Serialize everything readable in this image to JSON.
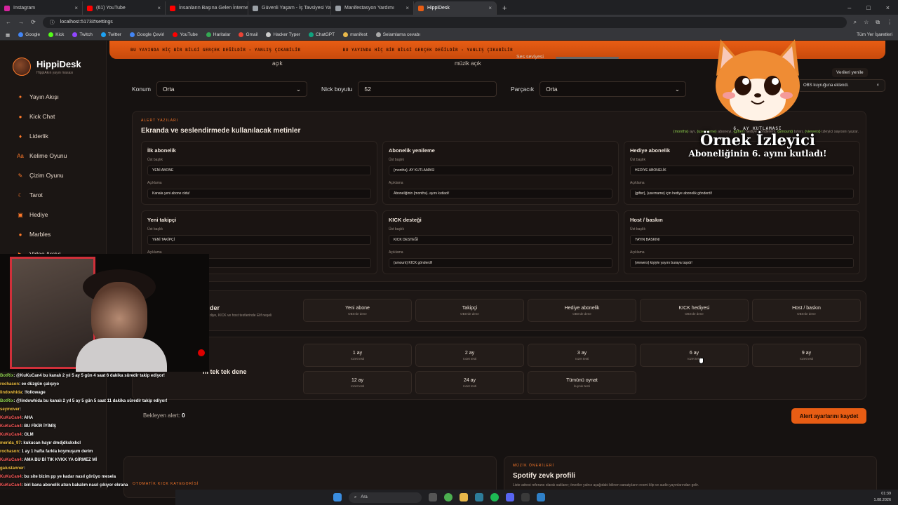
{
  "browser": {
    "tabs": [
      {
        "label": "Instagram",
        "color": "#d6249f"
      },
      {
        "label": "(61) YouTube",
        "color": "#ff0000"
      },
      {
        "label": "İnsanların Başına Gelen İnternet",
        "color": "#ff0000"
      },
      {
        "label": "Güvenli Yaşam - İş Tavsiyesi Yarı",
        "color": "#9aa0a6"
      },
      {
        "label": "Manifestasyon Yardımı",
        "color": "#9aa0a6"
      },
      {
        "label": "HippiDesk",
        "color": "#e85d14"
      }
    ],
    "url": "localhost:5173/#settings",
    "bookmarks": [
      "Google",
      "Kick",
      "Twitch",
      "Twitter",
      "Google Çeviri",
      "YouTube",
      "Haritalar",
      "Gmail",
      "Hacker Typer",
      "ChatGPT",
      "manifest",
      "Selamlama cevabı"
    ],
    "all_bookmarks": "Tüm Yer İşaretleri"
  },
  "sidebar": {
    "title": "HippiDesk",
    "subtitle": "HippiAkın yayın masası",
    "items": [
      {
        "label": "Yayın Akışı",
        "icon": "✦"
      },
      {
        "label": "Kick Chat",
        "icon": "●"
      },
      {
        "label": "Liderlik",
        "icon": "♦"
      },
      {
        "label": "Kelime Oyunu",
        "icon": "Aa"
      },
      {
        "label": "Çizim Oyunu",
        "icon": "✎"
      },
      {
        "label": "Tarot",
        "icon": "☾"
      },
      {
        "label": "Hediye",
        "icon": "▣"
      },
      {
        "label": "Marbles",
        "icon": "●"
      },
      {
        "label": "Video Arşivi",
        "icon": "▶"
      }
    ]
  },
  "banner": {
    "text": "BU YAYINDA HİÇ BİR BİLGİ GERÇEK DEĞİLDİR - YANLIŞ ÇIKABİLİR"
  },
  "top_row": {
    "left": "açık",
    "mid": "müzik açık",
    "volume": "Ses seviyesi"
  },
  "settings": {
    "position_label": "Konum",
    "position_value": "Orta",
    "nick_label": "Nick boyutu",
    "nick_value": "52",
    "particle_label": "Parçacık",
    "particle_value": "Orta"
  },
  "alerts": {
    "kicker": "ALERT YAZILARI",
    "heading": "Ekranda ve seslendirmede kullanılacak metinler",
    "hint": [
      "{months}",
      " ayı, ",
      "{username}",
      " aboneyi, ",
      "{gifter}",
      " hediye göndereni, ",
      "{amount}",
      " tutarı, ",
      "{viewers}",
      " izleyici sayısını yazar."
    ],
    "upper_label": "Üst başlık",
    "desc_label": "Açıklama",
    "cards": [
      {
        "title": "İlk abonelik",
        "upper": "YENİ ABONE",
        "desc": "Kanala yeni abone oldu!"
      },
      {
        "title": "Abonelik yenileme",
        "upper": "{months}. AY KUTLAMASI",
        "desc": "Aboneliğinin {months}. ayını kutladı!"
      },
      {
        "title": "Hediye abonelik",
        "upper": "HEDİYE ABONELİK",
        "desc": "{gifter}, {username} için hediye abonelik gönderdi!"
      },
      {
        "title": "Yeni takipçi",
        "upper": "YENİ TAKİPÇİ",
        "desc": ""
      },
      {
        "title": "KICK desteği",
        "upper": "KICK DESTEĞİ",
        "desc": "{amount} KICK gönderdi!"
      },
      {
        "title": "Host / baskın",
        "upper": "YAYIN BASKINI",
        "desc": "{viewers} kişiyle yayını buraya taşıdı!"
      }
    ]
  },
  "tests": {
    "heading": "der",
    "sub": "diye, KICK ve host testlerinde Elif neşeli",
    "buttons": [
      {
        "label": "Yeni abone",
        "sub": "OBS'de dene"
      },
      {
        "label": "Takipçi",
        "sub": "OBS'de dene"
      },
      {
        "label": "Hediye abonelik",
        "sub": "OBS'de dene"
      },
      {
        "label": "KICK hediyesi",
        "sub": "OBS'de dene"
      },
      {
        "label": "Host / baskın",
        "sub": "OBS'de dene"
      }
    ]
  },
  "badges": {
    "heading": "ni tek tek dene",
    "buttons": [
      {
        "label": "1 ay",
        "sub": "rozet testi"
      },
      {
        "label": "2 ay",
        "sub": "rozet testi"
      },
      {
        "label": "3 ay",
        "sub": "rozet testi"
      },
      {
        "label": "6 ay",
        "sub": "rozet testi"
      },
      {
        "label": "9 ay",
        "sub": "rozet testi"
      },
      {
        "label": "12 ay",
        "sub": "rozet testi"
      },
      {
        "label": "24 ay",
        "sub": "rozet testi"
      },
      {
        "label": "Tümünü oynat",
        "sub": "kuyruk testi"
      }
    ]
  },
  "pending": {
    "label": "Bekleyen alert:",
    "count": "0"
  },
  "save_button": "Alert ayarlarını kaydet",
  "music": {
    "kicker": "MÜZİK ÖNERİLERİ",
    "heading": "Spotify zevk profili",
    "desc": "Liste adresi referans olarak saklanır; öneriler yalnız aşağıdaki bilinen sanatçıların resmi klip ve audio yayınlarından gelir.",
    "left_kicker": "OTOMATİK KICK KATEGORİSİ"
  },
  "toast": {
    "text": "OBS kuyruğuna eklendi.",
    "close": "×"
  },
  "topright_btn": "Verileri yenile",
  "overlay": {
    "small": "6. AY KUTLAMASI",
    "name": "Örnek İzleyici",
    "sub": "Aboneliğinin 6. ayını kutladı!"
  },
  "chat": [
    {
      "user": "BotRix",
      "msg": ": @KuKuCan4 bu kanalı 2 yıl 5 ay 5 gün 4 saat 6 dakika süredir takip ediyor!"
    },
    {
      "user": "rochason",
      "msg": ": ee düzgün çalışıyo"
    },
    {
      "user": "lindowhida",
      "msg": ": !followage"
    },
    {
      "user": "BotRix",
      "msg": ": @lindowhida bu kanalı 2 yıl 5 ay 5 gün 5 saat 11 dakika süredir takip ediyor!"
    },
    {
      "user": "seymover",
      "msg": ":"
    },
    {
      "user": "KuKuCan4",
      "msg": ": AHA"
    },
    {
      "user": "KuKuCan4",
      "msg": ": BU FİKİR İYİMİŞ"
    },
    {
      "user": "KuKuCan4",
      "msg": ": OLM"
    },
    {
      "user": "merida_97",
      "msg": ": kukucan hayır dmdjdkskxkcl"
    },
    {
      "user": "rochason",
      "msg": ": 1 ay 1 hafta farkla koymuşum derim"
    },
    {
      "user": "KuKuCan4",
      "msg": ": AMA BU Bİ TIK KVKK YA GİRMEZ Mİ"
    },
    {
      "user": "gaiustanner",
      "msg": ":"
    },
    {
      "user": "KuKuCan4",
      "msg": ": bu site bizim pp ye kadar nasıl görüyo mesela"
    },
    {
      "user": "KuKuCan4",
      "msg": ": biri bana abonelik atsın bakalım nasıl çıkıyor ekrana"
    }
  ],
  "taskbar": {
    "search": "Ara",
    "time": "01:39",
    "date": "1.08.2026"
  }
}
